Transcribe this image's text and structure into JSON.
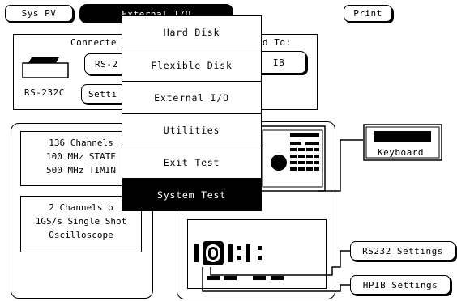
{
  "top_tabs": {
    "sys_pv": "Sys PV",
    "external_io": "External I/O",
    "print": "Print"
  },
  "io_panel": {
    "connected_to_left": "Connecte",
    "connected_to_right": "d To:",
    "rs232_button": "RS-2",
    "hpib_button": "IB",
    "rs232c_label": "RS-232C",
    "settings_button": "Setti"
  },
  "modules": {
    "analyzer_line1": "136 Channels",
    "analyzer_line2": "100 MHz STATE",
    "analyzer_line3": "500 MHz TIMIN",
    "scope_line1": "2 Channels o",
    "scope_line2": "1GS/s Single Shot",
    "scope_line3": "Oscilloscope"
  },
  "right_panel": {
    "keyboard": "Keyboard",
    "rs232_settings": "RS232 Settings",
    "hpib_settings": "HPIB Settings"
  },
  "dropdown_menu": {
    "items": [
      {
        "label": "Hard Disk"
      },
      {
        "label": "Flexible Disk"
      },
      {
        "label": "External I/O"
      },
      {
        "label": "Utilities"
      },
      {
        "label": "Exit Test"
      },
      {
        "label": "System Test"
      }
    ],
    "selected": "System Test"
  }
}
